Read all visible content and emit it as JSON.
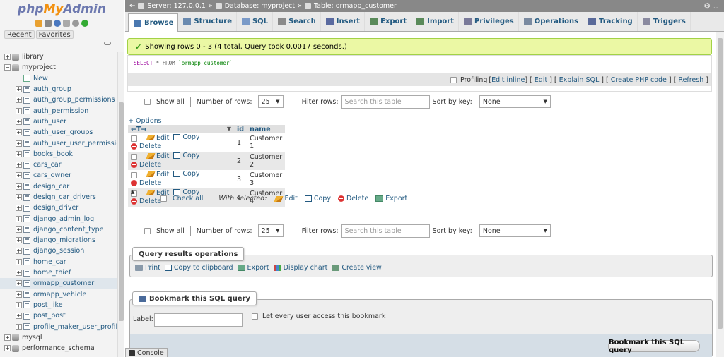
{
  "app": {
    "logo_php": "php",
    "logo_my": "My",
    "logo_admin": "Admin"
  },
  "sidebar": {
    "tabs": [
      "Recent",
      "Favorites"
    ],
    "tree": [
      {
        "label": "library",
        "type": "db",
        "indent": 0,
        "exp": "+"
      },
      {
        "label": "myproject",
        "type": "db",
        "indent": 0,
        "exp": "−"
      },
      {
        "label": "New",
        "type": "new",
        "indent": 1,
        "exp": ""
      },
      {
        "label": "auth_group",
        "type": "table",
        "indent": 1,
        "exp": "+"
      },
      {
        "label": "auth_group_permissions",
        "type": "table",
        "indent": 1,
        "exp": "+"
      },
      {
        "label": "auth_permission",
        "type": "table",
        "indent": 1,
        "exp": "+"
      },
      {
        "label": "auth_user",
        "type": "table",
        "indent": 1,
        "exp": "+"
      },
      {
        "label": "auth_user_groups",
        "type": "table",
        "indent": 1,
        "exp": "+"
      },
      {
        "label": "auth_user_user_permissions",
        "type": "table",
        "indent": 1,
        "exp": "+"
      },
      {
        "label": "books_book",
        "type": "table",
        "indent": 1,
        "exp": "+"
      },
      {
        "label": "cars_car",
        "type": "table",
        "indent": 1,
        "exp": "+"
      },
      {
        "label": "cars_owner",
        "type": "table",
        "indent": 1,
        "exp": "+"
      },
      {
        "label": "design_car",
        "type": "table",
        "indent": 1,
        "exp": "+"
      },
      {
        "label": "design_car_drivers",
        "type": "table",
        "indent": 1,
        "exp": "+"
      },
      {
        "label": "design_driver",
        "type": "table",
        "indent": 1,
        "exp": "+"
      },
      {
        "label": "django_admin_log",
        "type": "table",
        "indent": 1,
        "exp": "+"
      },
      {
        "label": "django_content_type",
        "type": "table",
        "indent": 1,
        "exp": "+"
      },
      {
        "label": "django_migrations",
        "type": "table",
        "indent": 1,
        "exp": "+"
      },
      {
        "label": "django_session",
        "type": "table",
        "indent": 1,
        "exp": "+"
      },
      {
        "label": "home_car",
        "type": "table",
        "indent": 1,
        "exp": "+"
      },
      {
        "label": "home_thief",
        "type": "table",
        "indent": 1,
        "exp": "+"
      },
      {
        "label": "ormapp_customer",
        "type": "table",
        "indent": 1,
        "exp": "+",
        "selected": true
      },
      {
        "label": "ormapp_vehicle",
        "type": "table",
        "indent": 1,
        "exp": "+"
      },
      {
        "label": "post_like",
        "type": "table",
        "indent": 1,
        "exp": "+"
      },
      {
        "label": "post_post",
        "type": "table",
        "indent": 1,
        "exp": "+"
      },
      {
        "label": "profile_maker_user_profile",
        "type": "table",
        "indent": 1,
        "exp": "+"
      },
      {
        "label": "mysql",
        "type": "db",
        "indent": 0,
        "exp": "+"
      },
      {
        "label": "performance_schema",
        "type": "db",
        "indent": 0,
        "exp": "+"
      }
    ]
  },
  "breadcrumb": {
    "server": "Server: 127.0.0.1",
    "database": "Database: myproject",
    "table": "Table: ormapp_customer",
    "sep": "»"
  },
  "tabs": [
    {
      "label": "Browse",
      "icon": "browse-icon",
      "color": "#4a78b0"
    },
    {
      "label": "Structure",
      "icon": "structure-icon",
      "color": "#6a8ab0"
    },
    {
      "label": "SQL",
      "icon": "sql-icon",
      "color": "#7a9ac8"
    },
    {
      "label": "Search",
      "icon": "search-icon",
      "color": "#8a8a8a"
    },
    {
      "label": "Insert",
      "icon": "insert-icon",
      "color": "#5a6aa0"
    },
    {
      "label": "Export",
      "icon": "export-icon",
      "color": "#5a8a5a"
    },
    {
      "label": "Import",
      "icon": "import-icon",
      "color": "#5a8a5a"
    },
    {
      "label": "Privileges",
      "icon": "privileges-icon",
      "color": "#7a7a9a"
    },
    {
      "label": "Operations",
      "icon": "operations-icon",
      "color": "#7a8aa0"
    },
    {
      "label": "Tracking",
      "icon": "tracking-icon",
      "color": "#5a6a9a"
    },
    {
      "label": "Triggers",
      "icon": "triggers-icon",
      "color": "#8a8aa0"
    }
  ],
  "message": "Showing rows 0 - 3 (4 total, Query took 0.0017 seconds.)",
  "sql": {
    "kw": "SELECT",
    "rest": " * FROM ",
    "table": "`ormapp_customer`"
  },
  "profiling": {
    "label": "Profiling",
    "links": [
      "Edit inline",
      "Edit",
      "Explain SQL",
      "Create PHP code",
      "Refresh"
    ]
  },
  "nav": {
    "show_all": "Show all",
    "num_rows_label": "Number of rows:",
    "num_rows": "25",
    "filter_label": "Filter rows:",
    "filter_placeholder": "Search this table",
    "sort_label": "Sort by key:",
    "sort_value": "None"
  },
  "options_link": "+ Options",
  "table": {
    "arrows": "←T→",
    "columns": [
      "id",
      "name"
    ],
    "rows": [
      {
        "id": "1",
        "name": "Customer 1"
      },
      {
        "id": "2",
        "name": "Customer 2"
      },
      {
        "id": "3",
        "name": "Customer 3"
      },
      {
        "id": "4",
        "name": "Customer 4"
      }
    ],
    "actions": {
      "edit": "Edit",
      "copy": "Copy",
      "delete": "Delete"
    }
  },
  "with_selected": {
    "check_all": "Check all",
    "label": "With selected:",
    "edit": "Edit",
    "copy": "Copy",
    "delete": "Delete",
    "export": "Export"
  },
  "query_ops": {
    "title": "Query results operations",
    "items": [
      "Print",
      "Copy to clipboard",
      "Export",
      "Display chart",
      "Create view"
    ]
  },
  "bookmark": {
    "title": "Bookmark this SQL query",
    "label": "Label:",
    "share_label": "Let every user access this bookmark",
    "button": "Bookmark this SQL query"
  },
  "console": "Console"
}
